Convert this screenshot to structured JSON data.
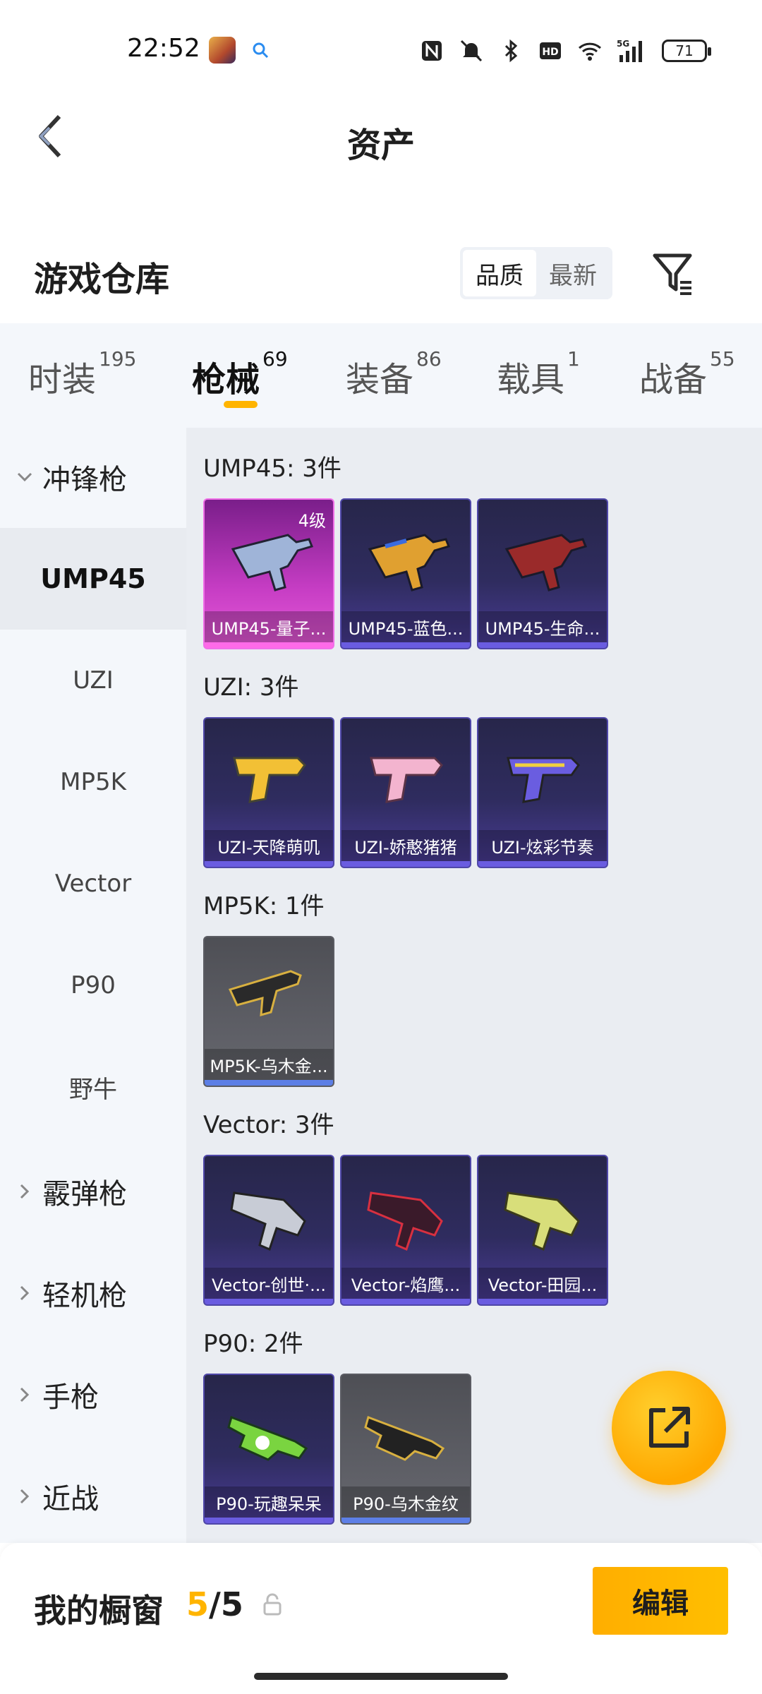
{
  "status_bar": {
    "time": "22:52",
    "battery": "71",
    "icons": [
      "game-app-icon",
      "search-icon",
      "nfc-icon",
      "mute-icon",
      "bluetooth-icon",
      "hd-icon",
      "wifi-icon",
      "5g-signal-icon",
      "battery-icon"
    ]
  },
  "header": {
    "title": "资产",
    "back_icon": "chevron-left-icon"
  },
  "warehouse": {
    "title": "游戏仓库",
    "sort_options": [
      "品质",
      "最新"
    ],
    "active_sort": "品质",
    "filter_icon": "filter-icon"
  },
  "tabs": [
    {
      "label": "时装",
      "count": "195"
    },
    {
      "label": "枪械",
      "count": "69"
    },
    {
      "label": "装备",
      "count": "86"
    },
    {
      "label": "载具",
      "count": "1"
    },
    {
      "label": "战备",
      "count": "55"
    }
  ],
  "active_tab": "枪械",
  "sidebar": {
    "expanded_group": "冲锋枪",
    "sub_items": [
      "UMP45",
      "UZI",
      "MP5K",
      "Vector",
      "P90",
      "野牛"
    ],
    "active_sub": "UMP45",
    "collapsed_groups": [
      "霰弹枪",
      "轻机枪",
      "手枪",
      "近战"
    ]
  },
  "sections": [
    {
      "title": "UMP45: 3件",
      "items": [
        {
          "name": "UMP45-量子...",
          "level": "4级",
          "style": "pink"
        },
        {
          "name": "UMP45-蓝色...",
          "style": "purple"
        },
        {
          "name": "UMP45-生命...",
          "style": "purple"
        }
      ]
    },
    {
      "title": "UZI: 3件",
      "items": [
        {
          "name": "UZI-天降萌叽",
          "style": "purple"
        },
        {
          "name": "UZI-娇憨猪猪",
          "style": "purple"
        },
        {
          "name": "UZI-炫彩节奏",
          "style": "purple"
        }
      ]
    },
    {
      "title": "MP5K: 1件",
      "items": [
        {
          "name": "MP5K-乌木金...",
          "style": "gray"
        }
      ]
    },
    {
      "title": "Vector: 3件",
      "items": [
        {
          "name": "Vector-创世·...",
          "style": "purple"
        },
        {
          "name": "Vector-焰鹰...",
          "style": "purple"
        },
        {
          "name": "Vector-田园...",
          "style": "purple"
        }
      ]
    },
    {
      "title": "P90: 2件",
      "items": [
        {
          "name": "P90-玩趣呆呆",
          "style": "purple"
        },
        {
          "name": "P90-乌木金纹",
          "style": "gray"
        }
      ]
    }
  ],
  "fab": {
    "icon": "share-external-icon"
  },
  "showcase": {
    "label": "我的橱窗",
    "current": "5",
    "separator": "/",
    "total": "5",
    "lock_icon": "lock-icon",
    "edit_label": "编辑"
  },
  "colors": {
    "accent": "#ffb400",
    "card_purple": "#2f2c5f",
    "card_pink": "#c63dc4",
    "card_gray": "#5d5e65"
  }
}
